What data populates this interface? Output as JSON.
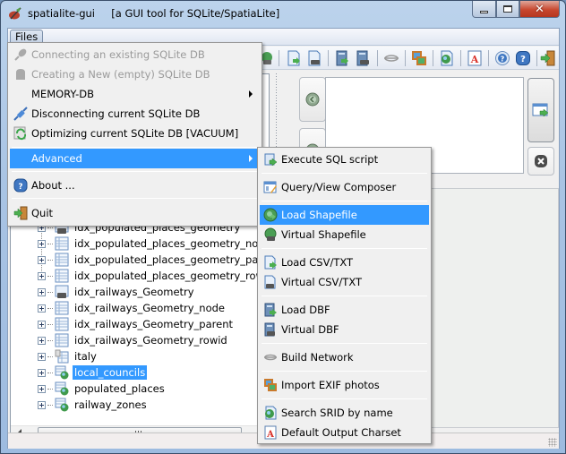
{
  "window": {
    "app_name": "spatialite-gui",
    "title": "spatialite-gui     [a GUI tool for SQLite/SpatiaLite]",
    "controls": {
      "minimize": "minimize",
      "maximize": "maximize",
      "close": "close"
    }
  },
  "menubar": {
    "files_label": "Files"
  },
  "toolbar": {
    "icons": [
      "virtual-shapefile-icon",
      "load-csv-icon",
      "virtual-csv-icon",
      "load-dbf-icon",
      "virtual-dbf-icon",
      "build-network-icon",
      "import-exif-icon",
      "search-srid-icon",
      "output-charset-icon",
      "help-icon",
      "about-icon",
      "quit-icon"
    ]
  },
  "files_menu": {
    "items": [
      {
        "label": "Connecting an existing SQLite DB",
        "icon": "plug-icon",
        "disabled": true
      },
      {
        "label": "Creating a New (empty) SQLite DB",
        "icon": "new-db-icon",
        "disabled": true
      },
      {
        "label": "MEMORY-DB",
        "icon": "",
        "submenu": true
      },
      {
        "label": "Disconnecting current SQLite DB",
        "icon": "disconnect-icon"
      },
      {
        "label": "Optimizing current SQLite DB [VACUUM]",
        "icon": "vacuum-icon"
      },
      {
        "label": "Advanced",
        "icon": "",
        "submenu": true,
        "highlighted": true
      },
      {
        "label": "About ...",
        "icon": "about-icon"
      },
      {
        "label": "Quit",
        "icon": "quit-icon"
      }
    ]
  },
  "advanced_menu": {
    "items": [
      {
        "label": "Execute SQL script",
        "icon": "sql-script-icon"
      },
      {
        "label": "Query/View Composer",
        "icon": "query-composer-icon"
      },
      {
        "label": "Load Shapefile",
        "icon": "load-shapefile-icon",
        "highlighted": true
      },
      {
        "label": "Virtual Shapefile",
        "icon": "virtual-shapefile-icon"
      },
      {
        "label": "Load CSV/TXT",
        "icon": "load-csv-icon"
      },
      {
        "label": "Virtual CSV/TXT",
        "icon": "virtual-csv-icon"
      },
      {
        "label": "Load DBF",
        "icon": "load-dbf-icon"
      },
      {
        "label": "Virtual DBF",
        "icon": "virtual-dbf-icon"
      },
      {
        "label": "Build Network",
        "icon": "build-network-icon"
      },
      {
        "label": "Import EXIF photos",
        "icon": "import-exif-icon"
      },
      {
        "label": "Search SRID by name",
        "icon": "search-srid-icon"
      },
      {
        "label": "Default Output Charset",
        "icon": "output-charset-icon"
      }
    ]
  },
  "tree": {
    "items": [
      {
        "label": "idx_populated_places_geometry",
        "icon": "virtual-table-icon"
      },
      {
        "label": "idx_populated_places_geometry_node",
        "icon": "table-icon"
      },
      {
        "label": "idx_populated_places_geometry_parent",
        "icon": "table-icon"
      },
      {
        "label": "idx_populated_places_geometry_rowid",
        "icon": "table-icon"
      },
      {
        "label": "idx_railways_Geometry",
        "icon": "virtual-table-icon"
      },
      {
        "label": "idx_railways_Geometry_node",
        "icon": "table-icon"
      },
      {
        "label": "idx_railways_Geometry_parent",
        "icon": "table-icon"
      },
      {
        "label": "idx_railways_Geometry_rowid",
        "icon": "table-icon"
      },
      {
        "label": "italy",
        "icon": "view-icon"
      },
      {
        "label": "local_councils",
        "icon": "geometry-table-icon",
        "selected": true
      },
      {
        "label": "populated_places",
        "icon": "geometry-table-icon"
      },
      {
        "label": "railway_zones",
        "icon": "geometry-table-icon"
      }
    ]
  },
  "sql_panel": {
    "editor_value": ""
  },
  "status": {
    "text": ""
  },
  "colors": {
    "highlight": "#3399ff",
    "disabled_text": "#9a9a9a"
  }
}
